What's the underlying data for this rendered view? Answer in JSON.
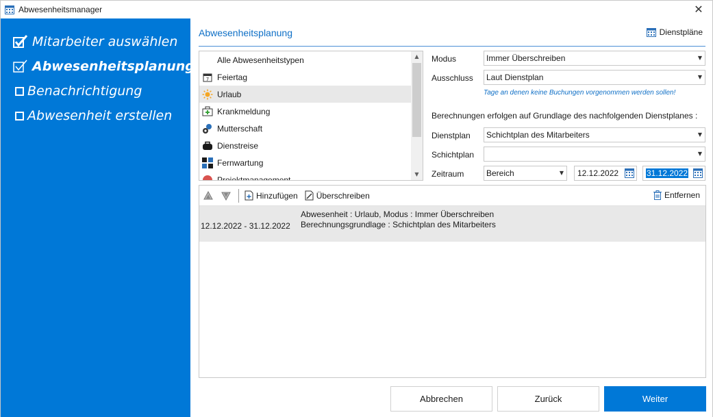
{
  "window": {
    "title": "Abwesenheitsmanager",
    "close_glyph": "✕"
  },
  "sidebar": {
    "steps": [
      {
        "label": "Mitarbeiter auswählen",
        "state": "done"
      },
      {
        "label": "Abwesenheitsplanung",
        "state": "current"
      },
      {
        "label": "Benachrichtigung",
        "state": "pending"
      },
      {
        "label": "Abwesenheit erstellen",
        "state": "pending"
      }
    ]
  },
  "header": {
    "title": "Abwesenheitsplanung",
    "plans_link": "Dienstpläne"
  },
  "types": {
    "items": [
      {
        "label": "Alle Abwesenheitstypen",
        "icon": "none"
      },
      {
        "label": "Feiertag",
        "icon": "calendar-icon"
      },
      {
        "label": "Urlaub",
        "icon": "sun-icon",
        "selected": true
      },
      {
        "label": "Krankmeldung",
        "icon": "medical-kit-icon"
      },
      {
        "label": "Mutterschaft",
        "icon": "pacifier-icon"
      },
      {
        "label": "Dienstreise",
        "icon": "briefcase-icon"
      },
      {
        "label": "Fernwartung",
        "icon": "windows-icon"
      },
      {
        "label": "Projektmanagement",
        "icon": "project-icon"
      }
    ]
  },
  "form": {
    "modus_label": "Modus",
    "modus_value": "Immer Überschreiben",
    "ausschluss_label": "Ausschluss",
    "ausschluss_value": "Laut Dienstplan",
    "ausschluss_hint": "Tage an denen keine Buchungen vorgenommen werden sollen!",
    "basis_text": "Berechnungen erfolgen auf Grundlage des nachfolgenden Dienstplanes :",
    "dienstplan_label": "Dienstplan",
    "dienstplan_value": "Schichtplan des Mitarbeiters",
    "schichtplan_label": "Schichtplan",
    "schichtplan_value": "",
    "zeitraum_label": "Zeitraum",
    "zeitraum_value": "Bereich",
    "date_from": "12.12.2022",
    "date_to": "31.12.2022"
  },
  "toolbar": {
    "add_label": "Hinzufügen",
    "overwrite_label": "Überschreiben",
    "remove_label": "Entfernen"
  },
  "entries": [
    {
      "range": "12.12.2022 - 31.12.2022",
      "line1": "Abwesenheit : Urlaub, Modus : Immer Überschreiben",
      "line2": "Berechnungsgrundlage : Schichtplan des Mitarbeiters"
    }
  ],
  "buttons": {
    "cancel": "Abbrechen",
    "back": "Zurück",
    "next": "Weiter"
  },
  "colors": {
    "accent": "#0078d7",
    "link": "#0e6fc6",
    "selection": "#e8e8e8"
  }
}
